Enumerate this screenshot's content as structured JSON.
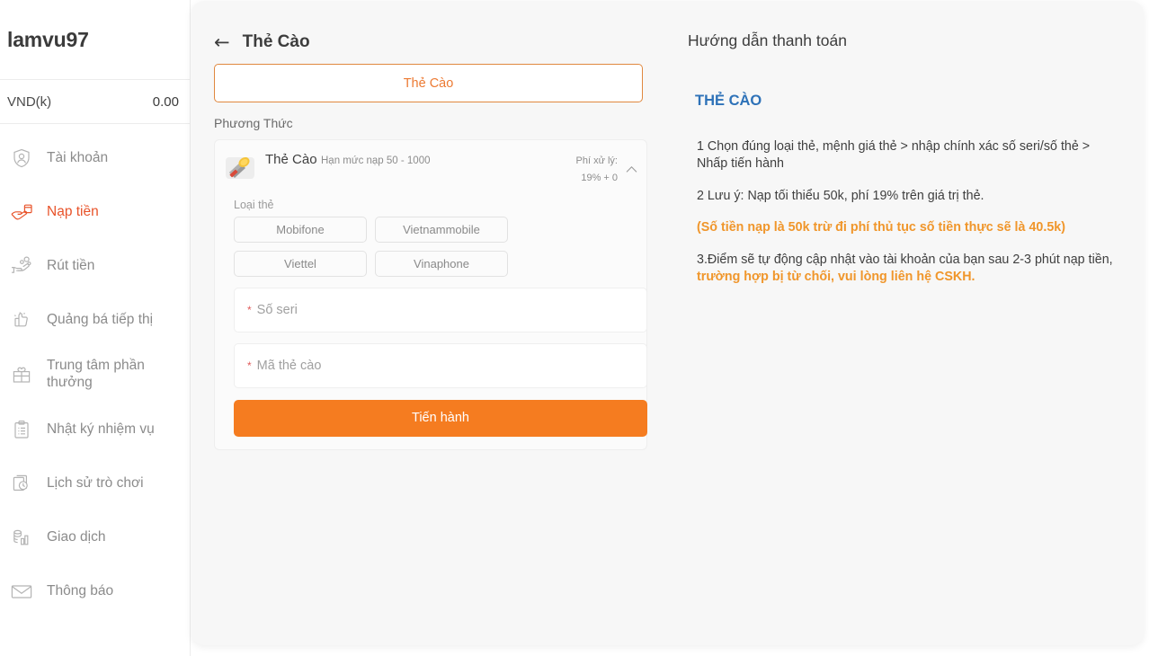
{
  "sidebar": {
    "username": "lamvu97",
    "balance": {
      "currency_label": "VND(k)",
      "amount": "0.00"
    },
    "items": [
      {
        "label": "Tài khoản",
        "icon": "shield-person-icon",
        "active": false
      },
      {
        "label": "Nạp tiền",
        "icon": "hand-card-icon",
        "active": true
      },
      {
        "label": "Rút tiền",
        "icon": "hand-coins-icon",
        "active": false
      },
      {
        "label": "Quảng bá tiếp thị",
        "icon": "thumbs-up-icon",
        "active": false
      },
      {
        "label": "Trung tâm phần thưởng",
        "icon": "gift-icon",
        "active": false
      },
      {
        "label": "Nhật ký nhiệm vụ",
        "icon": "clipboard-list-icon",
        "active": false
      },
      {
        "label": "Lịch sử trò chơi",
        "icon": "documents-clock-icon",
        "active": false
      },
      {
        "label": "Giao dịch",
        "icon": "coins-chart-icon",
        "active": false
      },
      {
        "label": "Thông báo",
        "icon": "envelope-icon",
        "active": false
      }
    ]
  },
  "payment": {
    "back_arrow": "←",
    "title": "Thẻ Cào",
    "method_tab_label": "Thẻ Cào",
    "method_section_label": "Phương Thức",
    "method": {
      "icon": "scratch-card-coin-icon",
      "name": "Thẻ Cào",
      "limit": "Hạn mức nạp 50 - 1000",
      "fee_label": "Phí xử lý:",
      "fee_value": "19% + 0",
      "chevron": "chevron-up-icon"
    },
    "carrier_label": "Loại thẻ",
    "carriers": [
      "Mobifone",
      "Vietnammobile",
      "Viettel",
      "Vinaphone"
    ],
    "fields": [
      {
        "required_mark": "*",
        "placeholder": "Số seri",
        "value": ""
      },
      {
        "required_mark": "*",
        "placeholder": "Mã thẻ cào",
        "value": ""
      }
    ],
    "submit_label": "Tiến hành"
  },
  "guide": {
    "title": "Hướng dẫn thanh toán",
    "subtitle": "THẺ CÀO",
    "step1": "1 Chọn đúng loại thẻ, mệnh giá thẻ > nhập chính xác số seri/số thẻ > Nhấp tiến hành",
    "step2": "2 Lưu ý: Nạp tối thiểu 50k, phí 19% trên giá trị thẻ.",
    "note": "(Số tiền nạp là 50k trừ đi phí thủ tục số tiền thực sẽ là 40.5k)",
    "step3_plain": "3.Điểm sẽ tự động cập nhật vào tài khoản của bạn sau 2-3 phút nạp tiền, ",
    "step3_orange": "trường hợp bị từ chối, vui lòng liên hệ CSKH."
  },
  "colors": {
    "accent_orange": "#f57c20",
    "active_red": "#e8532a",
    "tab_border": "#e0883f",
    "guide_blue": "#2e72b8",
    "note_orange": "#f0962b",
    "panel_bg": "#f7f7f7"
  }
}
